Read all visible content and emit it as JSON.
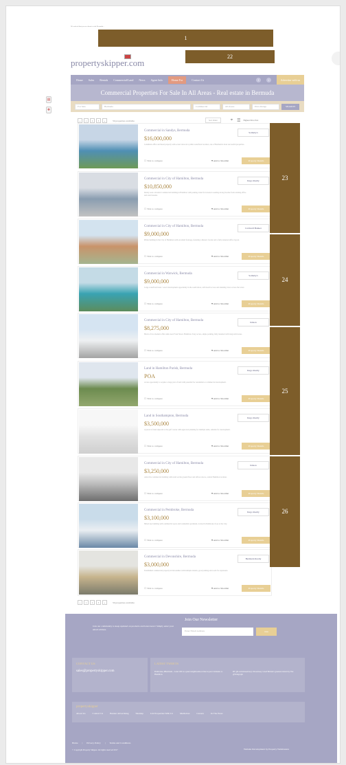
{
  "top_note": "We noticed that you are about to visit Bermuda...",
  "overlay": {
    "i": "1",
    "b": "22",
    "s1": "23",
    "s2": "24",
    "s3": "25",
    "s4": "26"
  },
  "logo": "propertyskipper.com",
  "nav": {
    "items": [
      "Home",
      "Sales",
      "Rentals",
      "Commercial/Land",
      "News",
      "Agent Info"
    ],
    "active": "Home For",
    "contact": "Contact Us",
    "advertise": "Advertise with us"
  },
  "banner": "Commercial Properties For Sale In All Areas - Real estate in Bermuda",
  "search": {
    "type": "For Sale",
    "area": "Bermuda",
    "commercial": "Commercial",
    "all_areas": "All Areas",
    "price": "Price Range",
    "button": "SEARCH"
  },
  "pager": {
    "pages": [
      "«",
      "1",
      "2",
      "3",
      "»"
    ],
    "count": "59 properties available"
  },
  "sort": {
    "label": "Sort Order",
    "highest": "Highest Price first"
  },
  "listings": [
    {
      "title": "Commercial in Sandys, Bermuda",
      "price": "$16,000,000",
      "desc": "Landmark office and hotel property with ocean views in a prime waterfront location, one of Bermuda's most successful properties.",
      "agency": "Sotheby's",
      "colors": [
        "#c7d6e6",
        "#4f8fb4",
        "#6e9a57"
      ]
    },
    {
      "title": "Commercial in City of Hamilton, Bermuda",
      "price": "$10,850,000",
      "desc": "Rarely seen a modern Commercial building in Hamilton with parking. Ideal for investors seeking strong income from existing office and retail tenants.",
      "agency": "Rego Realty",
      "colors": [
        "#d9dde3",
        "#8a9db0",
        "#c2c2c2"
      ]
    },
    {
      "title": "Commercial in City of Hamilton, Bermuda",
      "price": "$9,000,000",
      "desc": "Prime building in the City of Hamilton with excellent frontage, featuring a historic facade and a fully tenanted office layout.",
      "agency": "Coldwell Banker",
      "colors": [
        "#d3e3ef",
        "#c9936a",
        "#a5b58f"
      ]
    },
    {
      "title": "Commercial in Warwick, Bermuda",
      "price": "$9,000,000",
      "desc": "Large waterfront hotel / resort development opportunity in the south shore, with beach access and stunning views across the water.",
      "agency": "Sotheby's",
      "colors": [
        "#c4dbe6",
        "#39a3b2",
        "#5c8c5c"
      ]
    },
    {
      "title": "Commercial in City of Hamilton, Bermuda",
      "price": "$8,275,000",
      "desc": "Block of two modern office units near Front Street, Hamilton. Easy access, ample parking, fully tenanted with long term leases.",
      "agency": "Kitson",
      "colors": [
        "#d5e4f2",
        "#eef0f2",
        "#a3a3a3"
      ]
    },
    {
      "title": "Land in Hamilton Parish, Bermuda",
      "price": "POA",
      "desc": "A rare opportunity to acquire a large plot of land with potential for residential or commercial development.",
      "agency": "Rego Realty",
      "colors": [
        "#dfe6ee",
        "#6c8b4f",
        "#93a86e"
      ]
    },
    {
      "title": "Land in Southampton, Bermuda",
      "price": "$3,500,000",
      "desc": "A parcel of land adjacent to the golf course with approved planning for multiple units, suitable for development.",
      "agency": "Rego Realty",
      "colors": [
        "#f7f7f7",
        "#e2e2e2",
        "#cfcfcf"
      ]
    },
    {
      "title": "Commercial in City of Hamilton, Bermuda",
      "price": "$3,250,000",
      "desc": "Attractive commercial building with retail on the ground floor and offices above, central Hamilton location.",
      "agency": "Kitson",
      "colors": [
        "#e8e8e8",
        "#bdbdbd",
        "#6e6e6e"
      ]
    },
    {
      "title": "Commercial in Pembroke, Bermuda",
      "price": "$3,100,000",
      "desc": "Mixed use building with commercial space and residential apartment, located in Pembroke close to the City.",
      "agency": "Rego Realty",
      "colors": [
        "#c9dcea",
        "#eaeef2",
        "#6a88a6"
      ]
    },
    {
      "title": "Commercial in Devonshire, Bermuda",
      "price": "$3,000,000",
      "desc": "Established commercial property in Devonshire with multiple tenants, good parking and room for expansion.",
      "agency": "Bermuda Realty",
      "colors": [
        "#e4e4e0",
        "#c7b48d",
        "#7b7b6b"
      ]
    }
  ],
  "listing_actions": {
    "compare": "Tick to compare",
    "wishlist": "Add to Shortlist",
    "details": "Property Details"
  },
  "newsletter": {
    "title": "Join Our Newsletter",
    "text": "Join our community to keep updated on products and latest news! Simply enter your email address.",
    "placeholder": "Enter Email Address",
    "button": "Join"
  },
  "footer": {
    "contact_title": "CONTACT US",
    "email": "sales@propertyskipper.com",
    "tweets_title": "LATEST TWEETS",
    "tweet1": "Pembroke, #Bermuda - Land 100 is a quiet neighbourhood that is just 2 minutes to Hamilton.",
    "tweet2": "RT @LondonGuernsey: #Guernsey voted Britain's greenest island by The @Telegraph",
    "brand": "propertyskipper",
    "links": [
      "About Us",
      "Contact Us",
      "Banner Advertising",
      "Sitemap",
      "List Properties With Us",
      "Mediation",
      "Careers",
      "In The Press"
    ],
    "legal": [
      "Home",
      "Privacy Policy",
      "Terms and Conditions"
    ],
    "copyright": "© Copyright Property Skipper. All rights reserved 2017",
    "dev": "Website Development by Property Webmasters"
  }
}
